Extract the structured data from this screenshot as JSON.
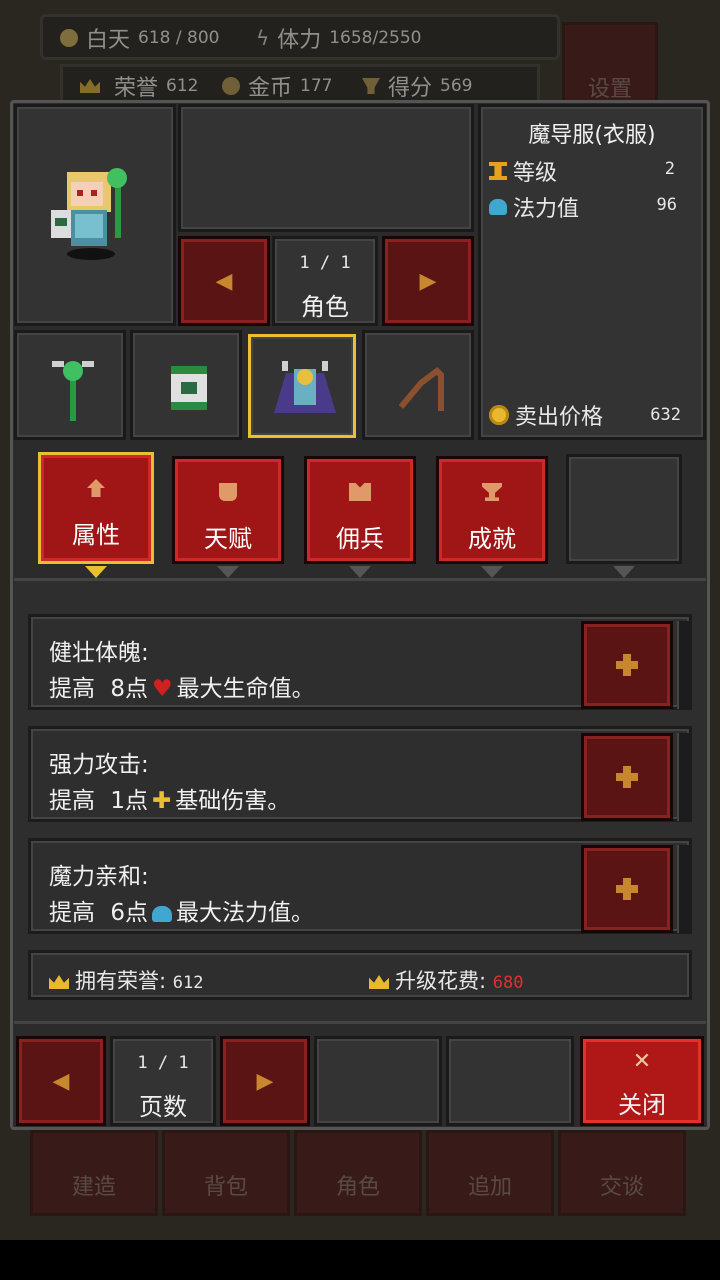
{
  "hud": {
    "day_label": "白天",
    "day_value": "618 / 800",
    "stamina_label": "体力",
    "stamina_value": "1658/2550",
    "honor_label": "荣誉",
    "honor_value": "612",
    "gold_label": "金币",
    "gold_value": "177",
    "score_label": "得分",
    "score_value": "569",
    "settings_label": "设置"
  },
  "bottom_nav": [
    "建造",
    "背包",
    "角色",
    "追加",
    "交谈"
  ],
  "item_info": {
    "name": "魔导服(衣服)",
    "level_label": "等级",
    "level_value": "2",
    "mana_label": "法力值",
    "mana_value": "96",
    "sell_label": "卖出价格",
    "sell_value": "632"
  },
  "character": {
    "pager": "1 / 1",
    "label": "角色"
  },
  "tabs": [
    {
      "label": "属性",
      "selected": true
    },
    {
      "label": "天赋",
      "selected": false
    },
    {
      "label": "佣兵",
      "selected": false
    },
    {
      "label": "成就",
      "selected": false
    }
  ],
  "stats": [
    {
      "title": "健壮体魄:",
      "prefix": "提高",
      "amount": "8点",
      "stat": "最大生命值。",
      "icon": "heart-icon"
    },
    {
      "title": "强力攻击:",
      "prefix": "提高",
      "amount": "1点",
      "stat": "基础伤害。",
      "icon": "sparkle-icon"
    },
    {
      "title": "魔力亲和:",
      "prefix": "提高",
      "amount": "6点",
      "stat": "最大法力值。",
      "icon": "potion-icon"
    }
  ],
  "honor_summary": {
    "own_label": "拥有荣誉:",
    "own_value": "612",
    "cost_label": "升级花费:",
    "cost_value": "680",
    "cost_color": "#e03030"
  },
  "footer": {
    "pager": "1 / 1",
    "page_label": "页数",
    "close_label": "关闭"
  },
  "colors": {
    "accent_gold": "#e8c030",
    "button_red": "#a01515",
    "arrow_orange": "#c8862e"
  }
}
